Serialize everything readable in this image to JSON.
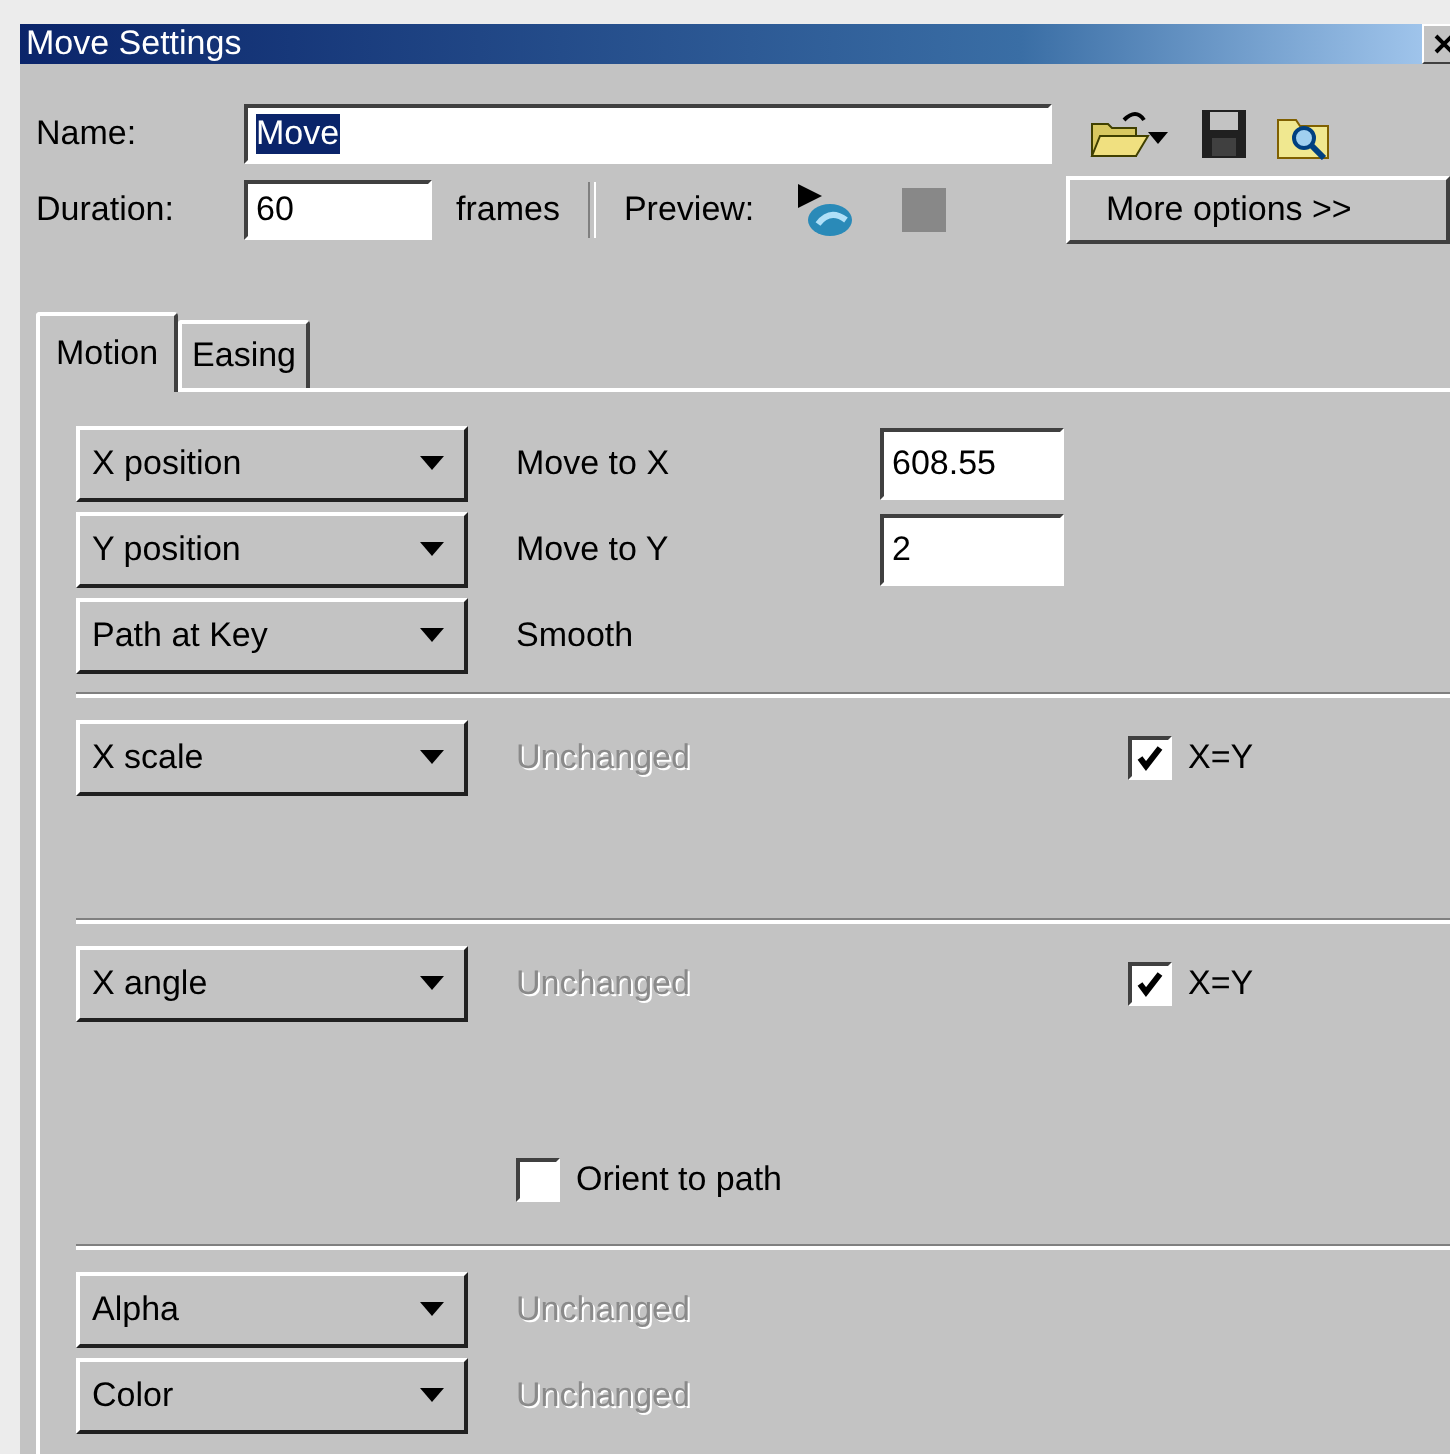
{
  "window": {
    "title": "Move Settings"
  },
  "name_field": {
    "label": "Name:",
    "value": "Move",
    "selected": true
  },
  "duration_field": {
    "label": "Duration:",
    "value": "60",
    "unit": "frames"
  },
  "preview": {
    "label": "Preview:"
  },
  "more_button": "More options >>",
  "tabs": [
    {
      "label": "Motion",
      "selected": true
    },
    {
      "label": "Easing",
      "selected": false
    }
  ],
  "sections": [
    {
      "rows": [
        {
          "kind": "field",
          "dropdown": "X position",
          "label": "Move to X",
          "value": "608.55",
          "disabled": false
        },
        {
          "kind": "field",
          "dropdown": "Y position",
          "label": "Move to Y",
          "value": "2",
          "disabled": false
        },
        {
          "kind": "text",
          "dropdown": "Path at Key",
          "label": "Smooth",
          "disabled": false
        }
      ]
    },
    {
      "rows": [
        {
          "kind": "linked",
          "dropdown": "X scale",
          "label": "Unchanged",
          "disabled": true,
          "check_label": "X=Y",
          "checked": true
        }
      ]
    },
    {
      "rows": [
        {
          "kind": "linked",
          "dropdown": "X angle",
          "label": "Unchanged",
          "disabled": true,
          "check_label": "X=Y",
          "checked": true
        },
        {
          "kind": "option",
          "label": "Orient to path",
          "checked": false
        }
      ]
    },
    {
      "rows": [
        {
          "kind": "text",
          "dropdown": "Alpha",
          "label": "Unchanged",
          "disabled": true
        },
        {
          "kind": "text",
          "dropdown": "Color",
          "label": "Unchanged",
          "disabled": true
        }
      ]
    }
  ]
}
